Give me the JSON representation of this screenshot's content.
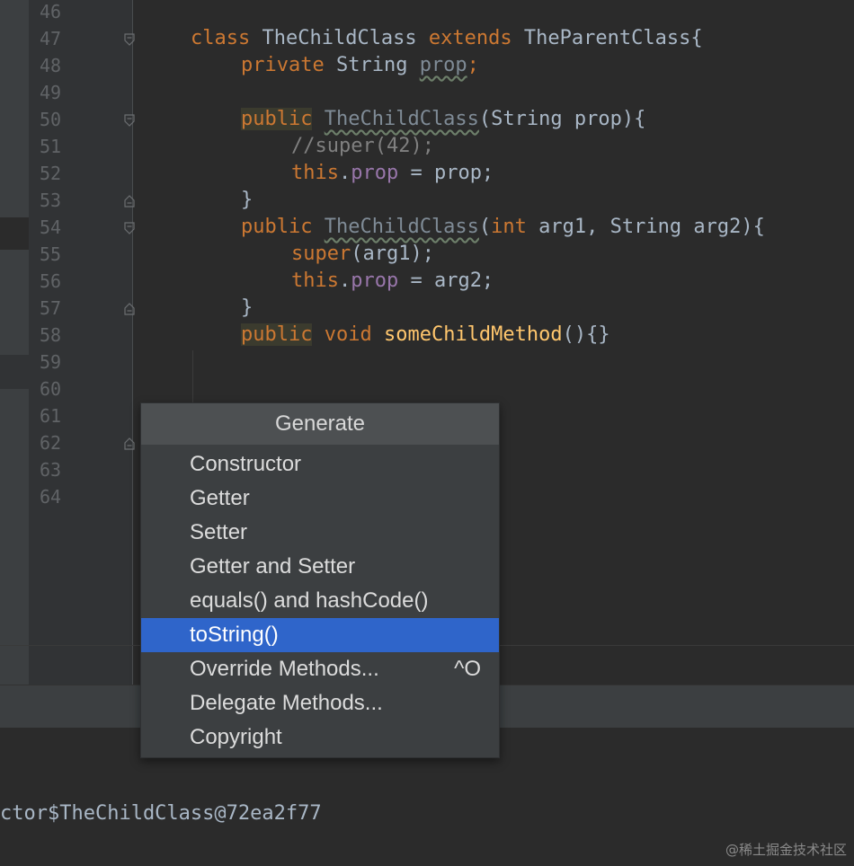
{
  "editor": {
    "line_numbers": [
      "46",
      "47",
      "48",
      "49",
      "50",
      "51",
      "52",
      "53",
      "54",
      "55",
      "56",
      "57",
      "58",
      "59",
      "60",
      "61",
      "62",
      "63",
      "64"
    ],
    "code": {
      "l47": {
        "a": "class ",
        "b": "TheChildClass ",
        "c": "extends ",
        "d": "TheParentClass{"
      },
      "l48": {
        "a": "private ",
        "b": "String ",
        "c": "prop",
        "d": ";"
      },
      "l50": {
        "a": "public",
        "b": " ",
        "c": "TheChildClass",
        "d": "(String prop){"
      },
      "l51": {
        "a": "//super(42);"
      },
      "l52": {
        "a": "this",
        "b": ".",
        "c": "prop",
        "d": " = prop;"
      },
      "l53": {
        "a": "}"
      },
      "l54": {
        "a": "public",
        "b": " ",
        "c": "TheChildClass",
        "d": "(",
        "e": "int",
        "f": " arg1, ",
        "g": "String arg2){"
      },
      "l55": {
        "a": "super",
        "b": "(arg1);"
      },
      "l56": {
        "a": "this",
        "b": ".",
        "c": "prop",
        "d": " = arg2;"
      },
      "l57": {
        "a": "}"
      },
      "l58": {
        "a": "public",
        "b": " ",
        "c": "void ",
        "d": "someChildMethod",
        "e": "(){}"
      }
    }
  },
  "popup": {
    "title": "Generate",
    "items": [
      {
        "label": "Constructor",
        "shortcut": ""
      },
      {
        "label": "Getter",
        "shortcut": ""
      },
      {
        "label": "Setter",
        "shortcut": ""
      },
      {
        "label": "Getter and Setter",
        "shortcut": ""
      },
      {
        "label": "equals() and hashCode()",
        "shortcut": ""
      },
      {
        "label": "toString()",
        "shortcut": ""
      },
      {
        "label": "Override Methods...",
        "shortcut": "^O"
      },
      {
        "label": "Delegate Methods...",
        "shortcut": ""
      },
      {
        "label": "Copyright",
        "shortcut": ""
      }
    ],
    "selected_item": "toString()"
  },
  "console": {
    "output": "ctor$TheChildClass@72ea2f77"
  },
  "watermark": "@稀土掘金技术社区",
  "colors": {
    "keyword": "#cc7832",
    "method": "#ffc66d",
    "field": "#9876aa",
    "comment": "#808080",
    "selection": "#2f65ca"
  },
  "icons": {
    "fold_open": "fold-open-icon",
    "fold_close": "fold-close-icon"
  }
}
